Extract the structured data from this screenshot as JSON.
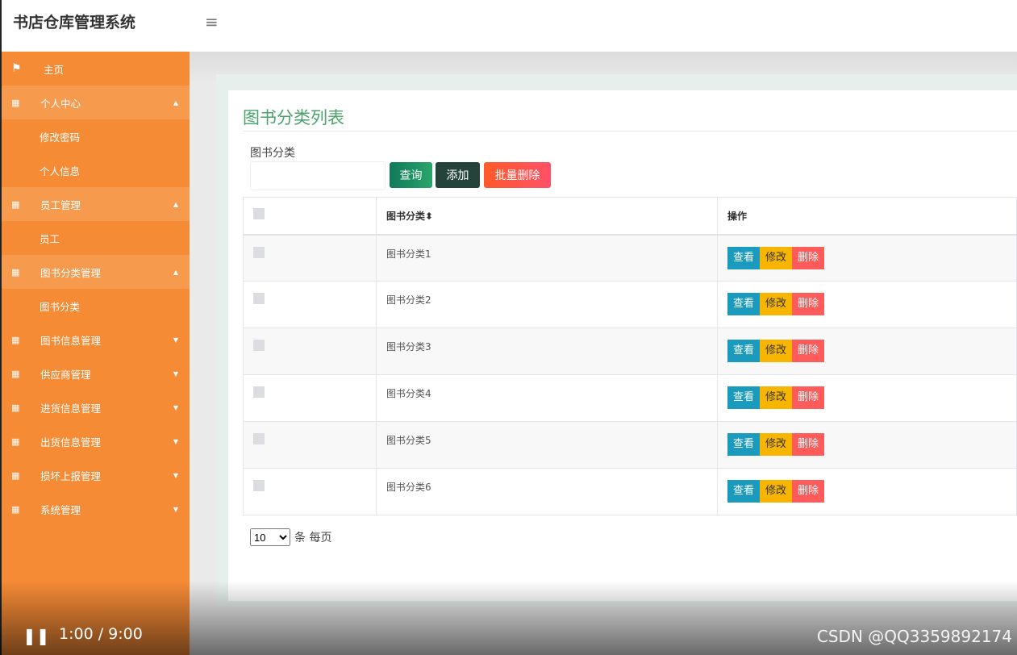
{
  "header": {
    "brand": "书店仓库管理系统"
  },
  "sidebar": {
    "items": [
      {
        "label": "主页",
        "type": "top",
        "icon": "flag-icon"
      },
      {
        "label": "个人中心",
        "type": "parent",
        "expanded": true
      },
      {
        "label": "修改密码",
        "type": "sub"
      },
      {
        "label": "个人信息",
        "type": "sub"
      },
      {
        "label": "员工管理",
        "type": "parent",
        "expanded": true
      },
      {
        "label": "员工",
        "type": "sub"
      },
      {
        "label": "图书分类管理",
        "type": "parent",
        "expanded": true
      },
      {
        "label": "图书分类",
        "type": "sub"
      },
      {
        "label": "图书信息管理",
        "type": "collapsed"
      },
      {
        "label": "供应商管理",
        "type": "collapsed"
      },
      {
        "label": "进货信息管理",
        "type": "collapsed"
      },
      {
        "label": "出货信息管理",
        "type": "collapsed"
      },
      {
        "label": "损坏上报管理",
        "type": "collapsed"
      },
      {
        "label": "系统管理",
        "type": "collapsed"
      }
    ]
  },
  "main": {
    "title": "图书分类列表",
    "filter_label": "图书分类",
    "search_value": "",
    "buttons": {
      "query": "查询",
      "add": "添加",
      "batch_delete": "批量删除"
    },
    "table": {
      "headers": [
        "图书分类",
        "操作"
      ],
      "sort_icon": "⬍",
      "rows": [
        "图书分类1",
        "图书分类2",
        "图书分类3",
        "图书分类4",
        "图书分类5",
        "图书分类6"
      ],
      "actions": {
        "view": "查看",
        "edit": "修改",
        "delete": "删除"
      }
    },
    "pager": {
      "page_size": "10",
      "suffix": "条 每页"
    }
  },
  "video": {
    "time": "1:00 / 9:00",
    "watermark": "CSDN @QQ3359892174"
  },
  "colors": {
    "sidebar": "#f68b36",
    "title": "#4aa36b",
    "view": "#1a9bbd",
    "edit": "#f7b500",
    "delete": "#ff5b5b"
  }
}
